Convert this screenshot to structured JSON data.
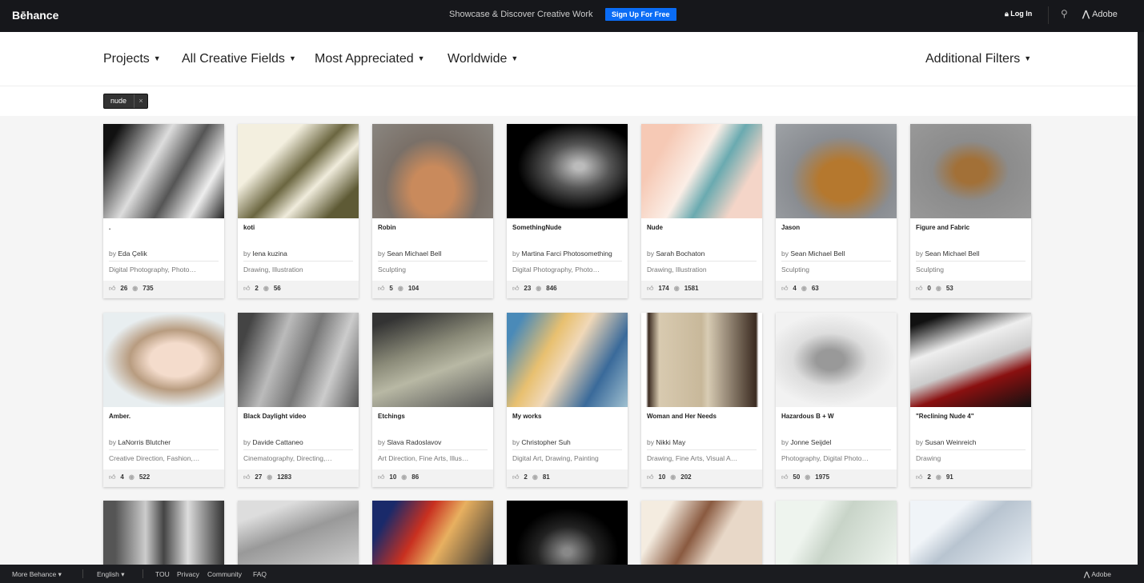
{
  "header": {
    "logo": "Bēhance",
    "tagline": "Showcase & Discover Creative Work",
    "signup": "Sign Up For Free",
    "login": "Log In",
    "adobe": "Adobe"
  },
  "filters": {
    "items": [
      "Projects",
      "All Creative Fields",
      "Most Appreciated",
      "Worldwide"
    ],
    "additional": "Additional Filters"
  },
  "tag": {
    "label": "nude",
    "remove": "×"
  },
  "projects": [
    {
      "title": ".",
      "owner": "Eda Çelik",
      "fields": "Digital Photography, Photo…",
      "likes": "26",
      "views": "735",
      "bg": "linear-gradient(120deg,#111 10%,#ddd 40%,#555 60%,#eee 80%,#222)"
    },
    {
      "title": "koti",
      "owner": "Iena kuzina",
      "fields": "Drawing, Illustration",
      "likes": "2",
      "views": "56",
      "bg": "linear-gradient(135deg,#f3efdf 30%,#6b6640 50%,#f0ecdc 65%,#5e5a35 85%)"
    },
    {
      "title": "Robin",
      "owner": "Sean Michael Bell",
      "fields": "Sculpting",
      "likes": "5",
      "views": "104",
      "bg": "radial-gradient(ellipse at 50% 70%,#c98a5c 25%,#7a7068 55%,#8a8680)"
    },
    {
      "title": "SomethingNude",
      "owner": "Martina Farci Photosomething",
      "fields": "Digital Photography, Photo…",
      "likes": "23",
      "views": "846",
      "bg": "radial-gradient(ellipse at 60% 45%,#bbb 5%,#555 30%,#000 60%)"
    },
    {
      "title": "Nude",
      "owner": "Sarah Bochaton",
      "fields": "Drawing, Illustration",
      "likes": "174",
      "views": "1581",
      "bg": "linear-gradient(120deg,#f6c9b5 20%,#fbeee6 45%,#6aaab0 60%,#f4d5c8 80%)"
    },
    {
      "title": "Jason",
      "owner": "Sean Michael Bell",
      "fields": "Sculpting",
      "likes": "4",
      "views": "63",
      "bg": "radial-gradient(ellipse at 55% 60%,#b5782e 25%,#8a8d92 55%,#9ea2a6)"
    },
    {
      "title": "Figure and Fabric",
      "owner": "Sean Michael Bell",
      "fields": "Sculpting",
      "likes": "0",
      "views": "53",
      "bg": "radial-gradient(ellipse at 50% 50%,#a27037 18%,#8c8c8c 45%,#999)"
    },
    {
      "title": "Amber.",
      "owner": "LaNorris Blutcher",
      "fields": "Creative Direction, Fashion,…",
      "likes": "4",
      "views": "522",
      "bg": "radial-gradient(ellipse at 60% 50%,#f4dccc 25%,#b89c80 45%,#e8eef0 70%)"
    },
    {
      "title": "Black Daylight video",
      "owner": "Davide Cattaneo",
      "fields": "Cinematography, Directing,…",
      "likes": "27",
      "views": "1283",
      "bg": "linear-gradient(110deg,#444 10%,#bbb 35%,#777 55%,#ccc 75%,#555)"
    },
    {
      "title": "Etchings",
      "owner": "Slava Radoslavov",
      "fields": "Art Direction, Fine Arts, Illus…",
      "likes": "10",
      "views": "86",
      "bg": "linear-gradient(160deg,#333 10%,#8a8a78 40%,#b8b8a4 60%,#555)"
    },
    {
      "title": "My works",
      "owner": "Christopher Suh",
      "fields": "Digital Art, Drawing, Painting",
      "likes": "2",
      "views": "81",
      "bg": "linear-gradient(120deg,#4a8ab8 10%,#e8c070 35%,#f0d8b8 50%,#3a6a9a 75%,#a0c0d0)"
    },
    {
      "title": "Woman and Her Needs",
      "owner": "Nikki May",
      "fields": "Drawing, Fine Arts, Visual A…",
      "likes": "10",
      "views": "202",
      "bg": "linear-gradient(90deg,#fff 4%,#3a2a20 6%,#d8cab0 15%,#c8b89a 50%,#d8ccb4 55%,#3a2a20 95%,#fff 97%)"
    },
    {
      "title": "Hazardous B + W",
      "owner": "Jonne Seijdel",
      "fields": "Photography, Digital Photo…",
      "likes": "50",
      "views": "1975",
      "bg": "radial-gradient(ellipse at 45% 50%,#999 15%,#ddd 40%,#f2f2f2 70%)"
    },
    {
      "title": "\"Reclining Nude 4\"",
      "owner": "Susan Weinreich",
      "fields": "Drawing",
      "likes": "2",
      "views": "91",
      "bg": "linear-gradient(160deg,#111 10%,#eee 35%,#ccc 55%,#8a1010 70%,#111)"
    },
    {
      "title": "",
      "owner": "",
      "fields": "",
      "likes": "",
      "views": "",
      "bg": "linear-gradient(90deg,#555 10%,#ccc 35%,#444 50%,#ddd 70%,#333)"
    },
    {
      "title": "",
      "owner": "",
      "fields": "",
      "likes": "",
      "views": "",
      "bg": "linear-gradient(160deg,#ddd 20%,#999 50%,#ccc)"
    },
    {
      "title": "",
      "owner": "",
      "fields": "",
      "likes": "",
      "views": "",
      "bg": "linear-gradient(120deg,#1a2a6a 15%,#c83020 40%,#e8b060 60%,#333)"
    },
    {
      "title": "",
      "owner": "",
      "fields": "",
      "likes": "",
      "views": "",
      "bg": "radial-gradient(ellipse at 50% 80%,#888 5%,#222 35%,#000 60%)"
    },
    {
      "title": "",
      "owner": "",
      "fields": "",
      "likes": "",
      "views": "",
      "bg": "linear-gradient(120deg,#f4ece0 20%,#8a5a40 45%,#e8d8c8 65%)"
    },
    {
      "title": "",
      "owner": "",
      "fields": "",
      "likes": "",
      "views": "",
      "bg": "linear-gradient(120deg,#eef4ee 30%,#c8d4c8 50%,#eef4ee)"
    },
    {
      "title": "",
      "owner": "",
      "fields": "",
      "likes": "",
      "views": "",
      "bg": "linear-gradient(140deg,#f0f4f8 30%,#b8c4d0 50%,#e8eef4)"
    }
  ],
  "card_by": "by",
  "footer": {
    "more": "More Behance",
    "lang": "English",
    "links": [
      "TOU",
      "Privacy",
      "Community",
      "FAQ"
    ],
    "adobe": "Adobe"
  }
}
